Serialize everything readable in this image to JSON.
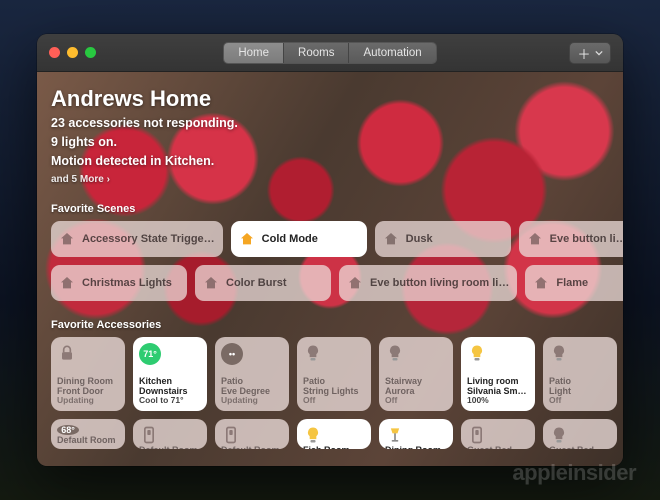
{
  "window": {
    "tabs": [
      "Home",
      "Rooms",
      "Automation"
    ],
    "activeTab": 0
  },
  "header": {
    "title": "Andrews Home",
    "status": [
      "23 accessories not responding.",
      "9 lights on.",
      "Motion detected in Kitchen."
    ],
    "more": "and 5 More ›"
  },
  "sections": {
    "scenesLabel": "Favorite Scenes",
    "accessoriesLabel": "Favorite Accessories"
  },
  "scenes": {
    "row1": [
      {
        "label": "Accessory State Trigge…",
        "active": false,
        "icon": "house"
      },
      {
        "label": "Cold Mode",
        "active": true,
        "icon": "house",
        "iconColor": "#f5a623"
      },
      {
        "label": "Dusk",
        "active": false,
        "icon": "house"
      },
      {
        "label": "Eve button li…",
        "active": false,
        "icon": "house"
      }
    ],
    "row2": [
      {
        "label": "Christmas Lights",
        "active": false,
        "icon": "house"
      },
      {
        "label": "Color Burst",
        "active": false,
        "icon": "house"
      },
      {
        "label": "Eve button living room li…",
        "active": false,
        "icon": "house"
      },
      {
        "label": "Flame",
        "active": false,
        "icon": "house"
      }
    ]
  },
  "accessories": {
    "row1": [
      {
        "room": "Dining Room",
        "name": "Front Door",
        "state": "Updating",
        "icon": "lock",
        "on": false
      },
      {
        "room": "Kitchen",
        "name": "Downstairs",
        "state": "Cool to 71°",
        "icon": "thermo",
        "badge": "71°",
        "thermoColor": "#2ecc71",
        "on": true
      },
      {
        "room": "Patio",
        "name": "Eve Degree",
        "state": "Updating",
        "icon": "thermo",
        "badge": "••",
        "thermoColor": "#7a6a64",
        "on": false
      },
      {
        "room": "Patio",
        "name": "String Lights",
        "state": "Off",
        "icon": "bulb",
        "on": false
      },
      {
        "room": "Stairway",
        "name": "Aurora",
        "state": "Off",
        "icon": "bulb",
        "on": false
      },
      {
        "room": "Living room",
        "name": "Silvania Sm…",
        "state": "100%",
        "icon": "bulb",
        "bulbColor": "#f5c542",
        "on": true
      },
      {
        "room": "Patio",
        "name": "Light",
        "state": "Off",
        "icon": "bulb",
        "on": false
      }
    ],
    "row2": [
      {
        "room": "Default Room",
        "name": "",
        "state": "",
        "icon": "thermo",
        "badge": "68°",
        "thermoColor": "#7a6a64",
        "on": false
      },
      {
        "room": "Default Room",
        "name": "",
        "state": "",
        "icon": "switch",
        "on": false
      },
      {
        "room": "Default Room",
        "name": "",
        "state": "",
        "icon": "switch",
        "on": false
      },
      {
        "room": "Fish Room",
        "name": "",
        "state": "",
        "icon": "bulb",
        "bulbColor": "#f5c542",
        "on": true
      },
      {
        "room": "Dining Room",
        "name": "",
        "state": "",
        "icon": "lamp",
        "lampColor": "#f5c542",
        "on": true
      },
      {
        "room": "Guest Bed…",
        "name": "",
        "state": "",
        "icon": "switch",
        "on": false
      },
      {
        "room": "Guest Bed…",
        "name": "",
        "state": "",
        "icon": "bulb",
        "on": false
      }
    ]
  },
  "watermark": "appleinsider"
}
